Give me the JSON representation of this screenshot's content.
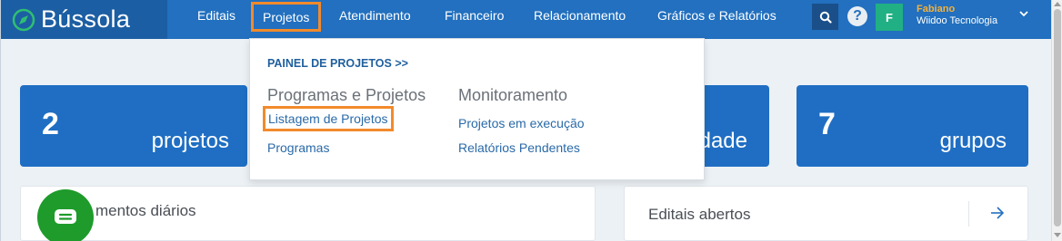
{
  "brand": {
    "name": "Bússola",
    "logo_icon": "compass-icon"
  },
  "nav": {
    "items": [
      {
        "label": "Editais"
      },
      {
        "label": "Projetos"
      },
      {
        "label": "Atendimento"
      },
      {
        "label": "Financeiro"
      },
      {
        "label": "Relacionamento"
      },
      {
        "label": "Gráficos e Relatórios"
      }
    ]
  },
  "header": {
    "search_icon": "search-icon",
    "help_label": "?",
    "avatar_initial": "F",
    "user_name": "Fabiano",
    "user_company": "Wiidoo Tecnologia",
    "chevron_icon": "chevron-down-icon"
  },
  "cards": [
    {
      "number": "2",
      "label": "projetos"
    },
    {
      "number": "",
      "label": "dade"
    },
    {
      "number": "7",
      "label": "grupos"
    }
  ],
  "panels": {
    "left_title": "mentos diários",
    "right_title": "Editais abertos",
    "arrow_icon": "arrow-right-icon"
  },
  "dropdown": {
    "header": "PAINEL DE PROJETOS >>",
    "col1_title": "Programas e Projetos",
    "col1_links": [
      "Listagem de Projetos",
      "Programas"
    ],
    "col2_title": "Monitoramento",
    "col2_links": [
      "Projetos em execução",
      "Relatórios Pendentes"
    ]
  },
  "colors": {
    "topbar": "#2270bf",
    "brand_bg": "#1c5ea3",
    "card": "#1f6ec3",
    "highlight": "#f28a2b",
    "chat": "#1e9b2b",
    "avatar": "#21b083"
  }
}
